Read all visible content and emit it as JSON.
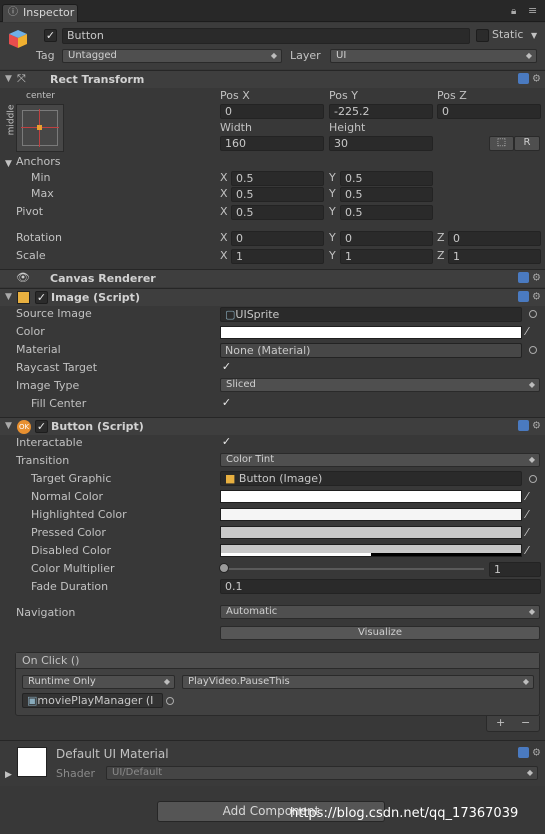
{
  "tab": {
    "title": "Inspector",
    "lock_icon": "lock-icon",
    "menu_icon": "menu-icon"
  },
  "object": {
    "name": "Button",
    "active": true,
    "static_label": "Static",
    "static_checked": false,
    "tag_label": "Tag",
    "tag_value": "Untagged",
    "layer_label": "Layer",
    "layer_value": "UI"
  },
  "rect": {
    "title": "Rect Transform",
    "anchor_h": "center",
    "anchor_v": "middle",
    "posx_label": "Pos X",
    "posy_label": "Pos Y",
    "posz_label": "Pos Z",
    "posx": "0",
    "posy": "-225.2",
    "posz": "0",
    "width_label": "Width",
    "height_label": "Height",
    "width": "160",
    "height": "30",
    "r_label": "R",
    "anchors_label": "Anchors",
    "min_label": "Min",
    "max_label": "Max",
    "pivot_label": "Pivot",
    "rotation_label": "Rotation",
    "scale_label": "Scale",
    "x": "X",
    "y": "Y",
    "z": "Z",
    "min_x": "0.5",
    "min_y": "0.5",
    "max_x": "0.5",
    "max_y": "0.5",
    "pivot_x": "0.5",
    "pivot_y": "0.5",
    "rot_x": "0",
    "rot_y": "0",
    "rot_z": "0",
    "scale_x": "1",
    "scale_y": "1",
    "scale_z": "1"
  },
  "canvas_renderer": {
    "title": "Canvas Renderer"
  },
  "image": {
    "title": "Image (Script)",
    "source_label": "Source Image",
    "source_value": "UISprite",
    "color_label": "Color",
    "color": "#ffffff",
    "material_label": "Material",
    "material_value": "None (Material)",
    "raycast_label": "Raycast Target",
    "raycast": true,
    "type_label": "Image Type",
    "type_value": "Sliced",
    "fill_center_label": "Fill Center",
    "fill_center": true
  },
  "button": {
    "title": "Button (Script)",
    "interactable_label": "Interactable",
    "interactable": true,
    "transition_label": "Transition",
    "transition_value": "Color Tint",
    "target_label": "Target Graphic",
    "target_value": "Button (Image)",
    "normal_label": "Normal Color",
    "normal_color": "#ffffff",
    "highlighted_label": "Highlighted Color",
    "highlighted_color": "#f5f5f5",
    "pressed_label": "Pressed Color",
    "pressed_color": "#c8c8c8",
    "disabled_label": "Disabled Color",
    "disabled_color": "#c8c8c8",
    "disabled_alpha": 0.5,
    "multiplier_label": "Color Multiplier",
    "multiplier": "1",
    "multiplier_min": 1,
    "multiplier_max": 5,
    "fade_label": "Fade Duration",
    "fade": "0.1",
    "navigation_label": "Navigation",
    "navigation_value": "Automatic",
    "visualize_label": "Visualize",
    "onclick_label": "On Click ()",
    "runtime_value": "Runtime Only",
    "function_value": "PlayVideo.PauseThis",
    "object_value": "moviePlayManager (I",
    "add_label": "+",
    "remove_label": "−"
  },
  "material": {
    "name": "Default UI Material",
    "shader_label": "Shader",
    "shader_value": "UI/Default"
  },
  "add_component_label": "Add Component",
  "watermark": "https://blog.csdn.net/qq_17367039"
}
